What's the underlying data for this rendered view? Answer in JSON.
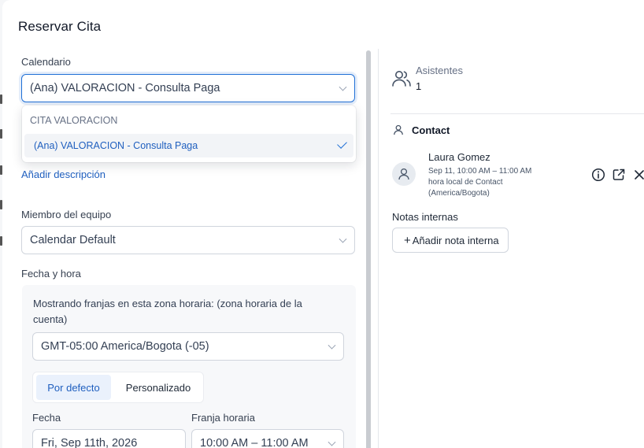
{
  "modal": {
    "title": "Reservar Cita"
  },
  "calendar": {
    "label": "Calendario",
    "value": "(Ana) VALORACION - Consulta Paga",
    "dropdown": {
      "group_label": "CITA VALORACION",
      "options": [
        {
          "label": "(Ana) VALORACION - Consulta Paga",
          "selected": true
        }
      ]
    }
  },
  "add_description": "Añadir descripción",
  "team_member": {
    "label": "Miembro del equipo",
    "value": "Calendar Default"
  },
  "datetime": {
    "label": "Fecha y hora",
    "timezone_notice": "Mostrando franjas en esta zona horaria: (zona horaria de la cuenta)",
    "timezone_value": "GMT-05:00 America/Bogota (-05)",
    "tabs": [
      {
        "label": "Por defecto",
        "active": true
      },
      {
        "label": "Personalizado",
        "active": false
      }
    ],
    "date_label": "Fecha",
    "date_value": "Fri, Sep 11th, 2026",
    "slot_label": "Franja horaria",
    "slot_value": "10:00 AM – 11:00 AM"
  },
  "attendees": {
    "label": "Asistentes",
    "count": "1",
    "icon": "users-icon"
  },
  "contact": {
    "section_label": "Contact",
    "name": "Laura Gomez",
    "time": "Sep 11, 10:00 AM – 11:00 AM",
    "tz_line1": "hora local de Contact",
    "tz_line2": "(America/Bogota)",
    "icons": [
      "info-icon",
      "external-link-icon",
      "close-icon"
    ]
  },
  "internal_notes": {
    "label": "Notas internas",
    "button": "Añadir nota interna"
  },
  "colors": {
    "accent": "#1f6fd6",
    "link": "#1f5fbf",
    "border": "#d0d5dd"
  }
}
